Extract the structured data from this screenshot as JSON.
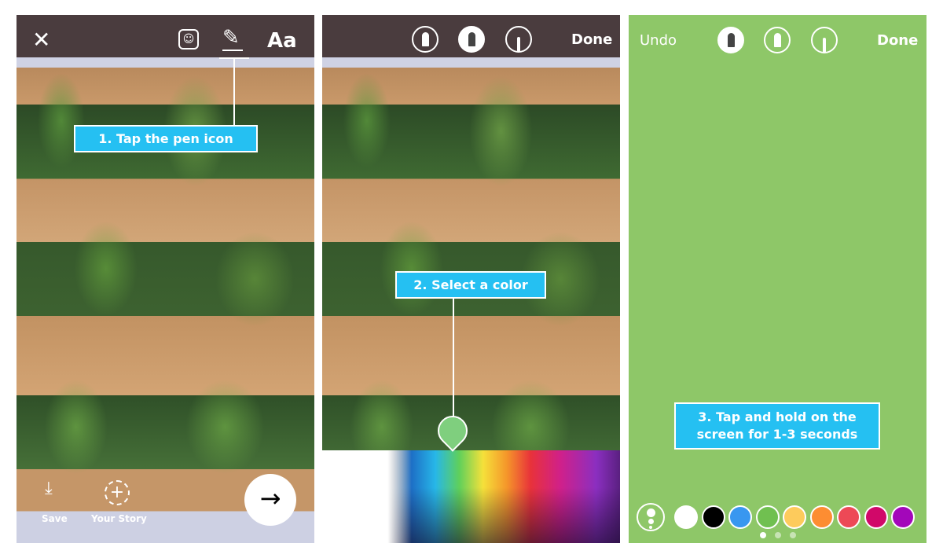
{
  "panel1": {
    "close_icon": "close-icon",
    "sticker_icon": "sticker-icon",
    "pen_icon": "pen-icon",
    "text_tool": "Aa",
    "callout": "1. Tap the pen icon",
    "save": "Save",
    "your_story": "Your Story",
    "next_icon": "arrow-right-icon"
  },
  "panel2": {
    "tools": [
      "marker-icon",
      "chisel-marker-icon",
      "neon-pen-icon"
    ],
    "done": "Done",
    "callout": "2. Select a color",
    "selected_color": "#7fcf7e"
  },
  "panel3": {
    "undo": "Undo",
    "done": "Done",
    "callout_line1": "3. Tap and hold on the",
    "callout_line2": "screen for 1-3 seconds",
    "background": "#8ec768",
    "swatches": [
      "#ffffff",
      "#000000",
      "#3897f0",
      "#70c050",
      "#fdcb5c",
      "#fd8d32",
      "#ed4956",
      "#d10869",
      "#a307ba"
    ],
    "page_dots": 3,
    "active_dot": 1
  }
}
